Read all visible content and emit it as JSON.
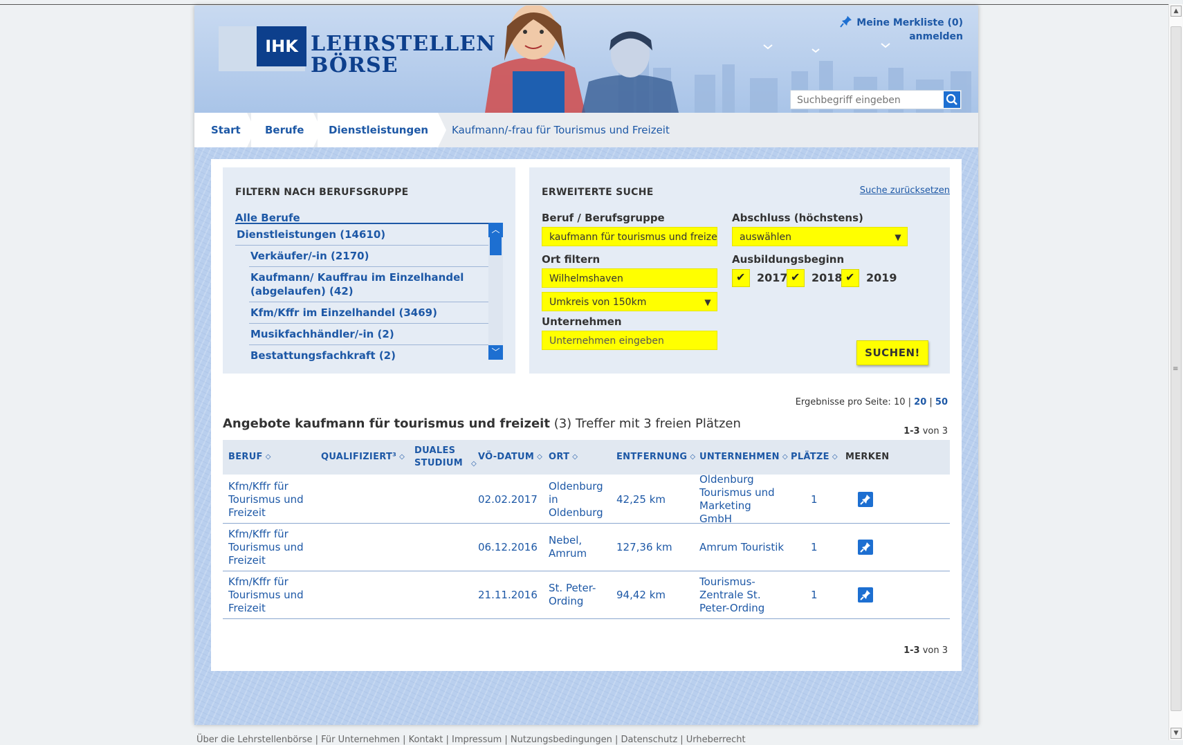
{
  "header": {
    "logo_ihk": "IHK",
    "logo_line1": "LEHRSTELLEN",
    "logo_line2": "BÖRSE",
    "merkliste": "Meine Merkliste (0)",
    "anmelden": "anmelden",
    "search_placeholder": "Suchbegriff eingeben"
  },
  "breadcrumb": {
    "items": [
      "Start",
      "Berufe",
      "Dienstleistungen"
    ],
    "current": "Kaufmann/-frau für Tourismus und Freizeit"
  },
  "filter": {
    "title": "FILTERN NACH BERUFSGRUPPE",
    "all": "Alle Berufe",
    "items": [
      {
        "label": "Dienstleistungen (14610)",
        "sub": false
      },
      {
        "label": "Verkäufer/-in (2170)",
        "sub": true
      },
      {
        "label": "Kaufmann/ Kauffrau im Einzelhandel (abgelaufen) (42)",
        "sub": true
      },
      {
        "label": "Kfm/Kffr im Einzelhandel (3469)",
        "sub": true
      },
      {
        "label": "Musikfachhändler/-in (2)",
        "sub": true
      },
      {
        "label": "Bestattungsfachkraft (2)",
        "sub": true
      }
    ]
  },
  "search": {
    "title": "ERWEITERTE SUCHE",
    "reset": "Suche zurücksetzen",
    "beruf_label": "Beruf / Berufsgruppe",
    "beruf_value": "kaufmann für tourismus und freizeit",
    "ort_label": "Ort filtern",
    "ort_value": "Wilhelmshaven",
    "umkreis_value": "Umkreis von 150km",
    "unternehmen_label": "Unternehmen",
    "unternehmen_placeholder": "Unternehmen eingeben",
    "abschluss_label": "Abschluss (höchstens)",
    "abschluss_value": "auswählen",
    "beginn_label": "Ausbildungsbeginn",
    "years": [
      "2017",
      "2018",
      "2019"
    ],
    "submit": "SUCHEN!"
  },
  "results": {
    "per_page_label": "Ergebnisse pro Seite:",
    "per_page": [
      "10",
      "20",
      "50"
    ],
    "heading_bold": "Angebote kaufmann für tourismus und freizeit",
    "heading_rest": "(3) Treffer mit 3 freien Plätzen",
    "range": "1-3",
    "of": "von 3",
    "columns": [
      "BERUF",
      "QUALIFIZIERT³",
      "DUALES STUDIUM",
      "VÖ-DATUM",
      "ORT",
      "ENTFERNUNG",
      "UNTERNEHMEN",
      "PLÄTZE",
      "MERKEN"
    ],
    "rows": [
      {
        "beruf": "Kfm/Kffr für Tourismus und Freizeit",
        "datum": "02.02.2017",
        "ort": "Oldenburg in Oldenburg",
        "entfernung": "42,25 km",
        "unternehmen": "Oldenburg Tourismus und Marketing GmbH",
        "plaetze": "1"
      },
      {
        "beruf": "Kfm/Kffr für Tourismus und Freizeit",
        "datum": "06.12.2016",
        "ort": "Nebel, Amrum",
        "entfernung": "127,36 km",
        "unternehmen": "Amrum Touristik",
        "plaetze": "1"
      },
      {
        "beruf": "Kfm/Kffr für Tourismus und Freizeit",
        "datum": "21.11.2016",
        "ort": "St. Peter-Ording",
        "entfernung": "94,42 km",
        "unternehmen": "Tourismus-Zentrale St. Peter-Ording",
        "plaetze": "1"
      }
    ]
  },
  "footer": "Über die Lehrstellenbörse | Für Unternehmen | Kontakt | Impressum | Nutzungsbedingungen | Datenschutz | Urheberrecht"
}
